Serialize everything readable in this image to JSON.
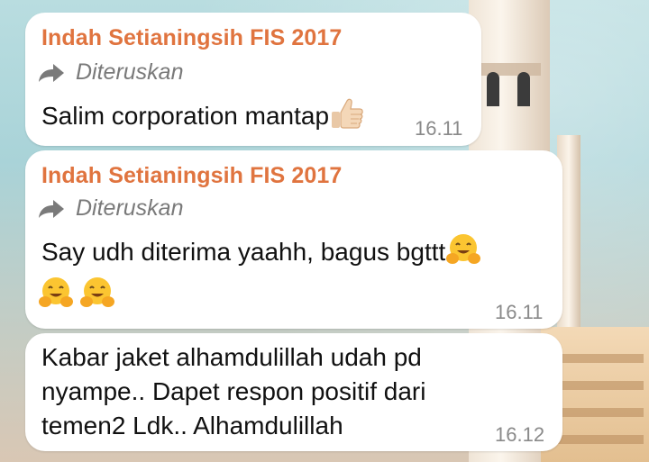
{
  "messages": [
    {
      "sender": "Indah Setianingsih FIS 2017",
      "forwarded_label": "Diteruskan",
      "text": "Salim corporation mantap",
      "emoji": [
        "thumbs-up"
      ],
      "time": "16.11"
    },
    {
      "sender": "Indah Setianingsih FIS 2017",
      "forwarded_label": "Diteruskan",
      "text": "Say udh diterima yaahh, bagus bgttt",
      "emoji": [
        "hugging-face",
        "hugging-face",
        "hugging-face"
      ],
      "time": "16.11"
    },
    {
      "text_lines": [
        "Kabar jaket alhamdulillah udah pd",
        "nyampe.. Dapet respon positif dari",
        "temen2 Ldk.. Alhamdulillah"
      ],
      "time": "16.12"
    }
  ],
  "colors": {
    "sender": "#e0743f",
    "bubble": "#ffffff",
    "timestamp": "#8a8a8a",
    "forwarded": "#7a7a7a"
  }
}
